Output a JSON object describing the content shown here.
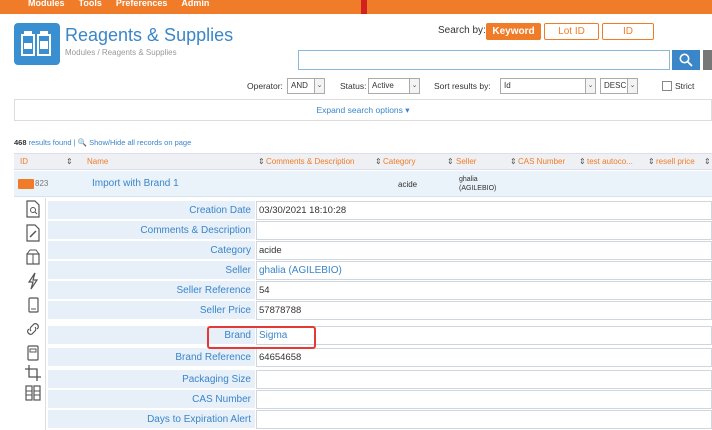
{
  "topbar": {
    "menu": [
      "Modules",
      "Tools",
      "Preferences",
      "Admin"
    ]
  },
  "header": {
    "title": "Reagents & Supplies",
    "breadcrumb": "Modules / Reagents & Supplies"
  },
  "search": {
    "search_by_label": "Search by:",
    "modes": [
      "Keyword",
      "Lot ID",
      "ID"
    ],
    "active_mode": "Keyword",
    "input_value": ""
  },
  "options": {
    "operator_label": "Operator:",
    "operator_value": "AND",
    "status_label": "Status:",
    "status_value": "Active",
    "sort_label": "Sort results by:",
    "sort_value": "Id",
    "order_value": "DESC",
    "strict_label": "Strict sear"
  },
  "expand_label": "Expand search options ▾",
  "results": {
    "count": "468",
    "text": "results found",
    "toggle": "| 🔍 Show/Hide all records on page"
  },
  "columns": [
    "ID",
    "Name",
    "Comments & Description",
    "Category",
    "Seller",
    "CAS Number",
    "test autoco...",
    "resell price"
  ],
  "record": {
    "id": "823",
    "name": "Import with Brand 1",
    "category": "acide",
    "seller": "ghalia (AGILEBIO)"
  },
  "details": [
    {
      "label": "Creation Date",
      "value": "03/30/2021 18:10:28"
    },
    {
      "label": "Comments & Description",
      "value": ""
    },
    {
      "label": "Category",
      "value": "acide"
    },
    {
      "label": "Seller",
      "value": "ghalia (AGILEBIO)"
    },
    {
      "label": "Seller Reference",
      "value": "54"
    },
    {
      "label": "Seller Price",
      "value": "57878788"
    },
    {
      "label": "Brand",
      "value": "Sigma"
    },
    {
      "label": "Brand Reference",
      "value": "64654658"
    },
    {
      "label": "Packaging Size",
      "value": ""
    },
    {
      "label": "CAS Number",
      "value": ""
    },
    {
      "label": "Days to Expiration Alert",
      "value": ""
    }
  ],
  "colors": {
    "accent": "#f07c2a",
    "link": "#3a86c8",
    "highlight": "#e53935"
  },
  "icons": [
    "view-icon",
    "edit-icon",
    "stock-icon",
    "activity-icon",
    "device-icon",
    "link-icon",
    "storage-icon",
    "crop-icon",
    "grid-icon"
  ]
}
